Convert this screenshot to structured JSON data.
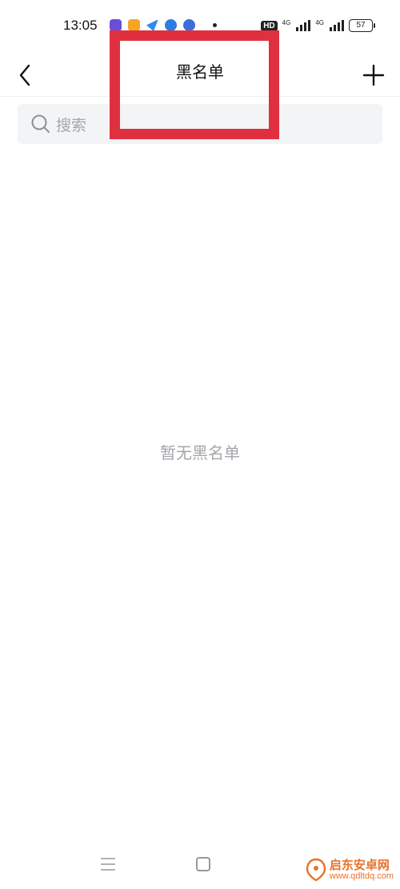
{
  "status_bar": {
    "time": "13:05",
    "network_badge": "HD",
    "signal_1_label": "4G",
    "signal_2_label": "4G",
    "battery_level": "57"
  },
  "header": {
    "title": "黑名单",
    "back_icon": "chevron-left-icon",
    "add_icon": "plus-icon"
  },
  "search": {
    "placeholder": "搜索"
  },
  "empty_state": {
    "message": "暂无黑名单"
  },
  "annotation": {
    "highlight_color": "#e03040"
  },
  "watermark": {
    "title": "启东安卓网",
    "url": "www.qdltdq.com"
  },
  "colors": {
    "text_primary": "#111111",
    "text_secondary": "#a3a6ab",
    "search_bg": "#f3f4f6",
    "watermark": "#e8722a"
  }
}
